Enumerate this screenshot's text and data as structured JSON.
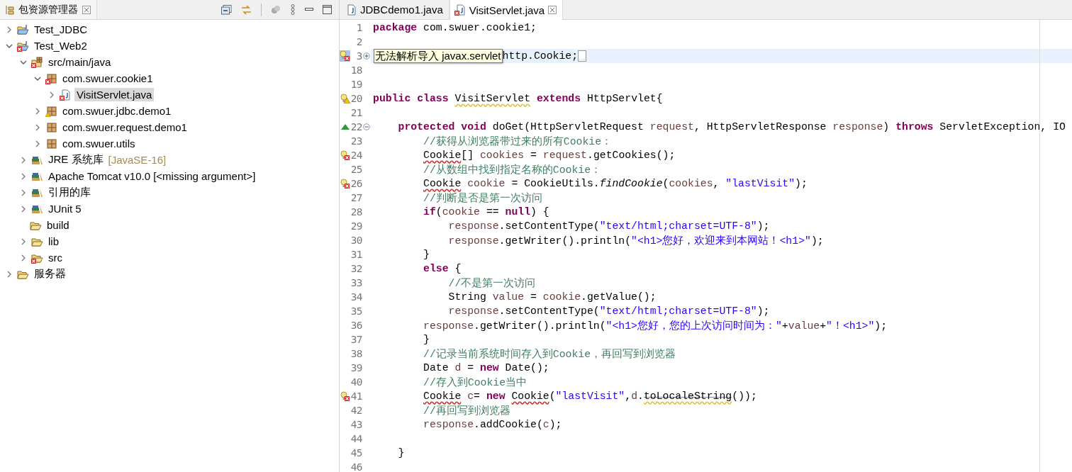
{
  "package_explorer": {
    "title": "包资源管理器",
    "tree": [
      {
        "label": "Test_JDBC",
        "kind": "project",
        "error": false,
        "expanded": false,
        "selected": false
      },
      {
        "label": "Test_Web2",
        "kind": "project",
        "error": true,
        "expanded": true,
        "selected": false,
        "children": [
          {
            "label": "src/main/java",
            "kind": "source-folder",
            "error": true,
            "expanded": true,
            "selected": false,
            "children": [
              {
                "label": "com.swuer.cookie1",
                "kind": "package",
                "error": true,
                "expanded": true,
                "selected": false,
                "children": [
                  {
                    "label": "VisitServlet.java",
                    "kind": "java-file",
                    "error": true,
                    "expanded": false,
                    "selected": true
                  }
                ]
              },
              {
                "label": "com.swuer.jdbc.demo1",
                "kind": "package",
                "error": false,
                "warning": true,
                "expanded": false,
                "selected": false
              },
              {
                "label": "com.swuer.request.demo1",
                "kind": "package",
                "error": false,
                "expanded": false,
                "selected": false
              },
              {
                "label": "com.swuer.utils",
                "kind": "package",
                "error": false,
                "expanded": false,
                "selected": false
              }
            ]
          },
          {
            "label": "JRE 系统库",
            "detail": "[JavaSE-16]",
            "kind": "library",
            "error": false,
            "expanded": false,
            "selected": false
          },
          {
            "label": "Apache Tomcat v10.0 [<missing argument>]",
            "kind": "library",
            "error": false,
            "expanded": false,
            "selected": false
          },
          {
            "label": "引用的库",
            "kind": "library",
            "error": false,
            "expanded": false,
            "selected": false
          },
          {
            "label": "JUnit 5",
            "kind": "library",
            "error": false,
            "expanded": false,
            "selected": false
          },
          {
            "label": "build",
            "kind": "folder",
            "error": false,
            "selected": false
          },
          {
            "label": "lib",
            "kind": "folder",
            "error": false,
            "expanded": false,
            "selected": false
          },
          {
            "label": "src",
            "kind": "folder",
            "error": true,
            "expanded": false,
            "selected": false
          }
        ]
      },
      {
        "label": "服务器",
        "kind": "folder",
        "error": false,
        "expanded": false,
        "selected": false
      }
    ]
  },
  "editor": {
    "tabs": [
      {
        "label": "JDBCdemo1.java",
        "error": false,
        "selected": false
      },
      {
        "label": "VisitServlet.java",
        "error": true,
        "selected": true
      }
    ],
    "lines": [
      {
        "number": "1",
        "segments": [
          {
            "text": "package",
            "kind": "keyword"
          },
          {
            "text": " com.swuer.cookie1;",
            "kind": "plain"
          }
        ]
      },
      {
        "number": "2"
      },
      {
        "number": "3",
        "error": true,
        "quick_fix": true,
        "collapsed": true,
        "selected": true,
        "tooltip": "无法解析导入 javax.servlet",
        "segments": [
          {
            "text": "http.Cookie;",
            "kind": "plain"
          }
        ]
      },
      {
        "number": "18"
      },
      {
        "number": "19"
      },
      {
        "number": "20",
        "warning": true,
        "segments": [
          {
            "text": "public class",
            "kind": "keyword"
          },
          {
            "text": " VisitServlet",
            "kind": "warning"
          },
          {
            "text": " extends",
            "kind": "keyword"
          },
          {
            "text": " HttpServlet{",
            "kind": "plain"
          }
        ]
      },
      {
        "number": "21"
      },
      {
        "number": "22",
        "overrides": true,
        "collapsed": false,
        "segments": [
          {
            "text": "    protected void",
            "kind": "keyword"
          },
          {
            "text": " doGet(HttpServletRequest",
            "kind": "plain"
          },
          {
            "text": " request",
            "kind": "variable"
          },
          {
            "text": ", HttpServletResponse",
            "kind": "plain"
          },
          {
            "text": " response",
            "kind": "variable"
          },
          {
            "text": ") ",
            "kind": "plain"
          },
          {
            "text": "throws",
            "kind": "keyword"
          },
          {
            "text": " ServletException, IO",
            "kind": "plain"
          }
        ]
      },
      {
        "number": "23",
        "segments": [
          {
            "text": "        //获得从浏览器带过来的所有Cookie：",
            "kind": "comment"
          }
        ]
      },
      {
        "number": "24",
        "error": true,
        "segments": [
          {
            "text": "        Cookie",
            "kind": "error"
          },
          {
            "text": "[]",
            "kind": "plain"
          },
          {
            "text": " cookies",
            "kind": "variable"
          },
          {
            "text": " =",
            "kind": "plain"
          },
          {
            "text": " request",
            "kind": "variable"
          },
          {
            "text": ".getCookies();",
            "kind": "plain"
          }
        ]
      },
      {
        "number": "25",
        "segments": [
          {
            "text": "        //从数组中找到指定名称的Cookie：",
            "kind": "comment"
          }
        ]
      },
      {
        "number": "26",
        "error": true,
        "segments": [
          {
            "text": "        Cookie",
            "kind": "error"
          },
          {
            "text": " cookie",
            "kind": "variable"
          },
          {
            "text": " = CookieUtils.",
            "kind": "plain"
          },
          {
            "text": "findCookie",
            "kind": "static"
          },
          {
            "text": "(",
            "kind": "plain"
          },
          {
            "text": "cookies",
            "kind": "variable"
          },
          {
            "text": ", ",
            "kind": "plain"
          },
          {
            "text": "\"lastVisit\"",
            "kind": "string"
          },
          {
            "text": ");",
            "kind": "plain"
          }
        ]
      },
      {
        "number": "27",
        "segments": [
          {
            "text": "        //判断是否是第一次访问",
            "kind": "comment"
          }
        ]
      },
      {
        "number": "28",
        "segments": [
          {
            "text": "        if",
            "kind": "keyword"
          },
          {
            "text": "(",
            "kind": "plain"
          },
          {
            "text": "cookie",
            "kind": "variable"
          },
          {
            "text": " == ",
            "kind": "plain"
          },
          {
            "text": "null",
            "kind": "keyword"
          },
          {
            "text": ") {",
            "kind": "plain"
          }
        ]
      },
      {
        "number": "29",
        "segments": [
          {
            "text": "            response",
            "kind": "variable"
          },
          {
            "text": ".setContentType(",
            "kind": "plain"
          },
          {
            "text": "\"text/html;charset=UTF-8\"",
            "kind": "string"
          },
          {
            "text": ");",
            "kind": "plain"
          }
        ]
      },
      {
        "number": "30",
        "segments": [
          {
            "text": "            response",
            "kind": "variable"
          },
          {
            "text": ".getWriter().println(",
            "kind": "plain"
          },
          {
            "text": "\"<h1>您好，欢迎来到本网站！<h1>\"",
            "kind": "string"
          },
          {
            "text": ");",
            "kind": "plain"
          }
        ]
      },
      {
        "number": "31",
        "segments": [
          {
            "text": "        }",
            "kind": "plain"
          }
        ]
      },
      {
        "number": "32",
        "segments": [
          {
            "text": "        else",
            "kind": "keyword"
          },
          {
            "text": " {",
            "kind": "plain"
          }
        ]
      },
      {
        "number": "33",
        "segments": [
          {
            "text": "            //不是第一次访问",
            "kind": "comment"
          }
        ]
      },
      {
        "number": "34",
        "segments": [
          {
            "text": "            String",
            "kind": "plain"
          },
          {
            "text": " value",
            "kind": "variable"
          },
          {
            "text": " = ",
            "kind": "plain"
          },
          {
            "text": "cookie",
            "kind": "variable"
          },
          {
            "text": ".getValue();",
            "kind": "plain"
          }
        ]
      },
      {
        "number": "35",
        "segments": [
          {
            "text": "            response",
            "kind": "variable"
          },
          {
            "text": ".setContentType(",
            "kind": "plain"
          },
          {
            "text": "\"text/html;charset=UTF-8\"",
            "kind": "string"
          },
          {
            "text": ");",
            "kind": "plain"
          }
        ]
      },
      {
        "number": "36",
        "segments": [
          {
            "text": "        response",
            "kind": "variable"
          },
          {
            "text": ".getWriter().println(",
            "kind": "plain"
          },
          {
            "text": "\"<h1>您好，您的上次访问时间为：\"",
            "kind": "string"
          },
          {
            "text": "+",
            "kind": "plain"
          },
          {
            "text": "value",
            "kind": "variable"
          },
          {
            "text": "+",
            "kind": "plain"
          },
          {
            "text": "\"！<h1>\"",
            "kind": "string"
          },
          {
            "text": ");",
            "kind": "plain"
          }
        ]
      },
      {
        "number": "37",
        "segments": [
          {
            "text": "        }",
            "kind": "plain"
          }
        ]
      },
      {
        "number": "38",
        "segments": [
          {
            "text": "        //记录当前系统时间存入到Cookie，再回写到浏览器",
            "kind": "comment"
          }
        ]
      },
      {
        "number": "39",
        "segments": [
          {
            "text": "        Date",
            "kind": "plain"
          },
          {
            "text": " d",
            "kind": "variable"
          },
          {
            "text": " = ",
            "kind": "plain"
          },
          {
            "text": "new",
            "kind": "keyword"
          },
          {
            "text": " Date();",
            "kind": "plain"
          }
        ]
      },
      {
        "number": "40",
        "segments": [
          {
            "text": "        //存入到Cookie当中",
            "kind": "comment"
          }
        ]
      },
      {
        "number": "41",
        "error": true,
        "segments": [
          {
            "text": "        Cookie",
            "kind": "error"
          },
          {
            "text": " c",
            "kind": "variable"
          },
          {
            "text": "= ",
            "kind": "plain"
          },
          {
            "text": "new",
            "kind": "keyword"
          },
          {
            "text": " Cookie",
            "kind": "error"
          },
          {
            "text": "(",
            "kind": "plain"
          },
          {
            "text": "\"lastVisit\"",
            "kind": "string"
          },
          {
            "text": ",",
            "kind": "plain"
          },
          {
            "text": "d",
            "kind": "variable"
          },
          {
            "text": ".",
            "kind": "plain"
          },
          {
            "text": "toLocaleString",
            "kind": "deprecated"
          },
          {
            "text": "());",
            "kind": "plain"
          }
        ]
      },
      {
        "number": "42",
        "segments": [
          {
            "text": "        //再回写到浏览器",
            "kind": "comment"
          }
        ]
      },
      {
        "number": "43",
        "segments": [
          {
            "text": "        response",
            "kind": "variable"
          },
          {
            "text": ".addCookie(",
            "kind": "plain"
          },
          {
            "text": "c",
            "kind": "variable"
          },
          {
            "text": ");",
            "kind": "plain"
          }
        ]
      },
      {
        "number": "44"
      },
      {
        "number": "45",
        "segments": [
          {
            "text": "    }",
            "kind": "plain"
          }
        ]
      },
      {
        "number": "46"
      }
    ]
  }
}
